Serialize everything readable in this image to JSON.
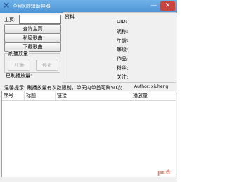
{
  "window": {
    "title": "全民K歌辅助神器",
    "minimize_glyph": "—",
    "close_glyph": "✕",
    "icon": "x-logo-icon"
  },
  "left_panel": {
    "homepage_label": "主页:",
    "homepage_value": "",
    "query_button": "查询主页",
    "private_button": "私密歌曲",
    "download_button": "下载歌曲",
    "play_group": {
      "title": "刷播放量",
      "start_button": "开始",
      "stop_button": "停止"
    },
    "played_label": "已刷播放量:"
  },
  "profile": {
    "title": "资料",
    "fields": [
      "UID:",
      "昵称:",
      "年龄:",
      "等级:",
      "作品:",
      "粉丝:",
      "关注:"
    ]
  },
  "tip": {
    "text": "温馨提示: 刷播放量有次数限制，单天内单首可刷50次",
    "author": "Author: xiuheng"
  },
  "table": {
    "columns": [
      "序号",
      "标题",
      "链接",
      "播放量"
    ]
  },
  "watermark": "pc6"
}
